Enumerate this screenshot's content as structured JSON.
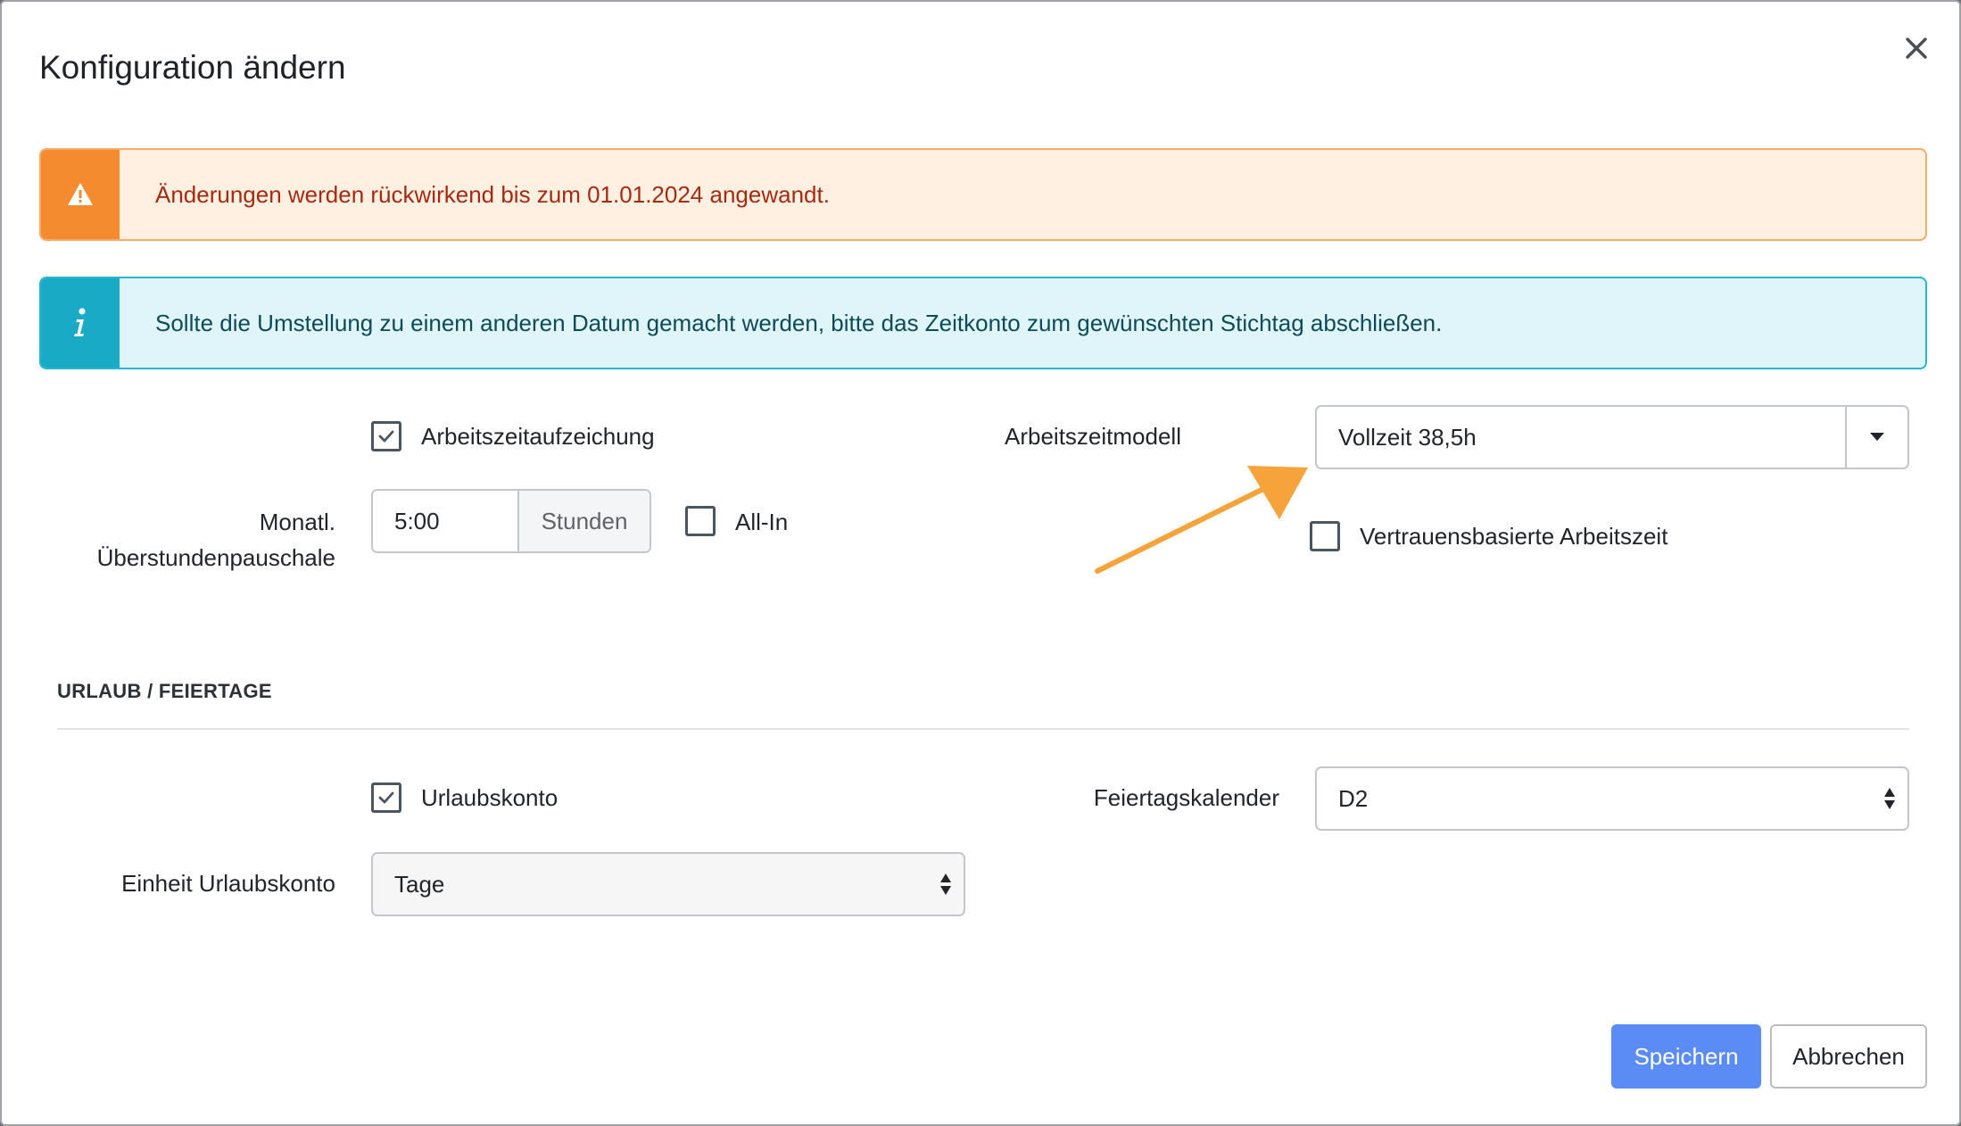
{
  "dialog": {
    "title": "Konfiguration ändern"
  },
  "alerts": {
    "warning": {
      "icon": "warning-icon",
      "text": "Änderungen werden rückwirkend bis zum 01.01.2024 angewandt.",
      "color": "#f58b2f"
    },
    "info": {
      "icon": "info-icon",
      "text": "Sollte die Umstellung zu einem anderen Datum gemacht werden, bitte das Zeitkonto zum gewünschten Stichtag abschließen.",
      "color": "#19abc6"
    }
  },
  "work_time": {
    "recording_label": "Arbeitszeitaufzeichung",
    "recording_checked": true,
    "overtime_label_line1": "Monatl.",
    "overtime_label_line2": "Überstundenpauschale",
    "overtime_value": "5:00",
    "overtime_unit": "Stunden",
    "all_in_label": "All-In",
    "all_in_checked": false,
    "model_label": "Arbeitszeitmodell",
    "model_value": "Vollzeit 38,5h",
    "trust_label": "Vertrauensbasierte Arbeitszeit",
    "trust_checked": false
  },
  "vacation": {
    "section_title": "URLAUB / FEIERTAGE",
    "account_label": "Urlaubskonto",
    "account_checked": true,
    "holiday_calendar_label": "Feiertagskalender",
    "holiday_calendar_value": "D2",
    "unit_label": "Einheit Urlaubskonto",
    "unit_value": "Tage"
  },
  "buttons": {
    "save": "Speichern",
    "cancel": "Abbrechen"
  },
  "colors": {
    "primary": "#5b8cf5",
    "annotation_arrow": "#f5a33a"
  }
}
